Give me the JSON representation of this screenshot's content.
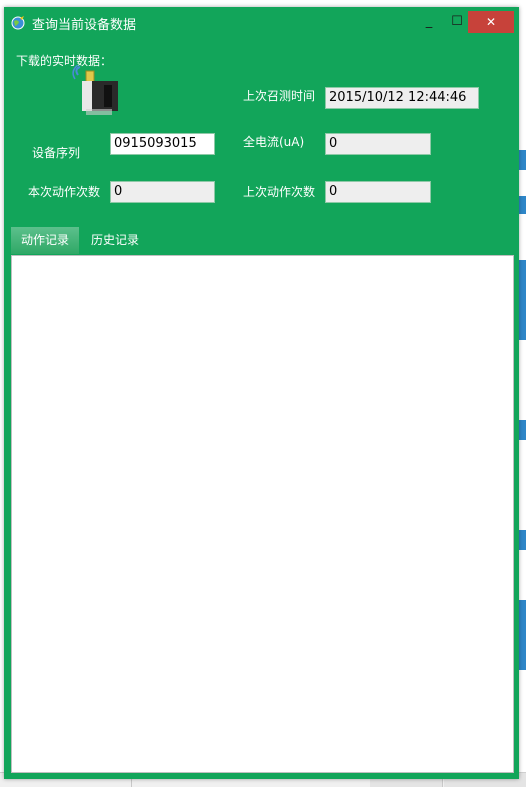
{
  "window": {
    "title": "查询当前设备数据",
    "close_glyph": "✕",
    "minimize_glyph": "_",
    "maximize_glyph": "☐"
  },
  "realtime": {
    "section_label": "下载的实时数据："
  },
  "fields": {
    "last_call_time": {
      "label": "上次召测时间",
      "value": "2015/10/12 12:44:46"
    },
    "device_serial": {
      "label": "设备序列",
      "value": "0915093015"
    },
    "full_current": {
      "label": "全电流(uA)",
      "value": "0"
    },
    "current_action_count": {
      "label": "本次动作次数",
      "value": "0"
    },
    "last_action_count": {
      "label": "上次动作次数",
      "value": "0"
    }
  },
  "tabs": [
    {
      "label": "动作记录",
      "active": true
    },
    {
      "label": "历史记录",
      "active": false
    }
  ],
  "colors": {
    "window_bg": "#12a55a",
    "close_button": "#c7423a"
  },
  "icons": {
    "app": "globe-icon",
    "device": "device-icon"
  }
}
